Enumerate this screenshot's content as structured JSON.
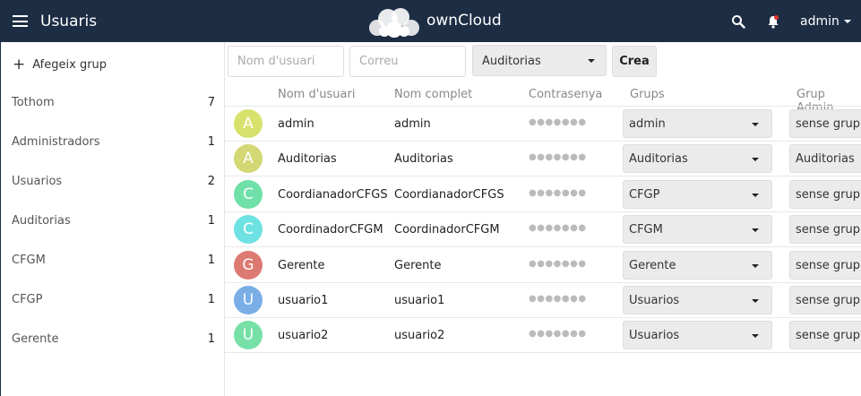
{
  "header": {
    "menu_icon": "hamburger-icon",
    "title": "Usuaris",
    "brand": "ownCloud",
    "logo_icon": "owncloud-logo",
    "search_icon": "search-icon",
    "notifications_icon": "bell-icon",
    "user": "admin",
    "bg_color": "#1d2d44"
  },
  "sidebar": {
    "add_group_label": "Afegeix grup",
    "groups": [
      {
        "name": "Tothom",
        "count": "7"
      },
      {
        "name": "Administradors",
        "count": "1"
      },
      {
        "name": "Usuarios",
        "count": "2"
      },
      {
        "name": "Auditorias",
        "count": "1"
      },
      {
        "name": "CFGM",
        "count": "1"
      },
      {
        "name": "CFGP",
        "count": "1"
      },
      {
        "name": "Gerente",
        "count": "1"
      }
    ]
  },
  "toolbar": {
    "username_placeholder": "Nom d'usuari",
    "email_placeholder": "Correu",
    "group_select": "Auditorias",
    "create_label": "Crea"
  },
  "table": {
    "columns": [
      "Nom d'usuari",
      "Nom complet",
      "Contrasenya",
      "Grups",
      "Grup Admin"
    ],
    "password_mask": "●●●●●●●",
    "rows": [
      {
        "initial": "A",
        "color": "#d6e26b",
        "username": "admin",
        "fullname": "admin",
        "groups": "admin",
        "admin_group": "sense grup"
      },
      {
        "initial": "A",
        "color": "#d3d774",
        "username": "Auditorias",
        "fullname": "Auditorias",
        "groups": "Auditorias",
        "admin_group": "Auditorias"
      },
      {
        "initial": "C",
        "color": "#6ee0a8",
        "username": "CoordianadorCFGS",
        "fullname": "CoordianadorCFGS",
        "groups": "CFGP",
        "admin_group": "sense grup"
      },
      {
        "initial": "C",
        "color": "#6ee2e2",
        "username": "CoordinadorCFGM",
        "fullname": "CoordinadorCFGM",
        "groups": "CFGM",
        "admin_group": "sense grup"
      },
      {
        "initial": "G",
        "color": "#dc7a72",
        "username": "Gerente",
        "fullname": "Gerente",
        "groups": "Gerente",
        "admin_group": "sense grup"
      },
      {
        "initial": "U",
        "color": "#79aee6",
        "username": "usuario1",
        "fullname": "usuario1",
        "groups": "Usuarios",
        "admin_group": "sense grup"
      },
      {
        "initial": "U",
        "color": "#77e0a7",
        "username": "usuario2",
        "fullname": "usuario2",
        "groups": "Usuarios",
        "admin_group": "sense grup"
      }
    ]
  }
}
